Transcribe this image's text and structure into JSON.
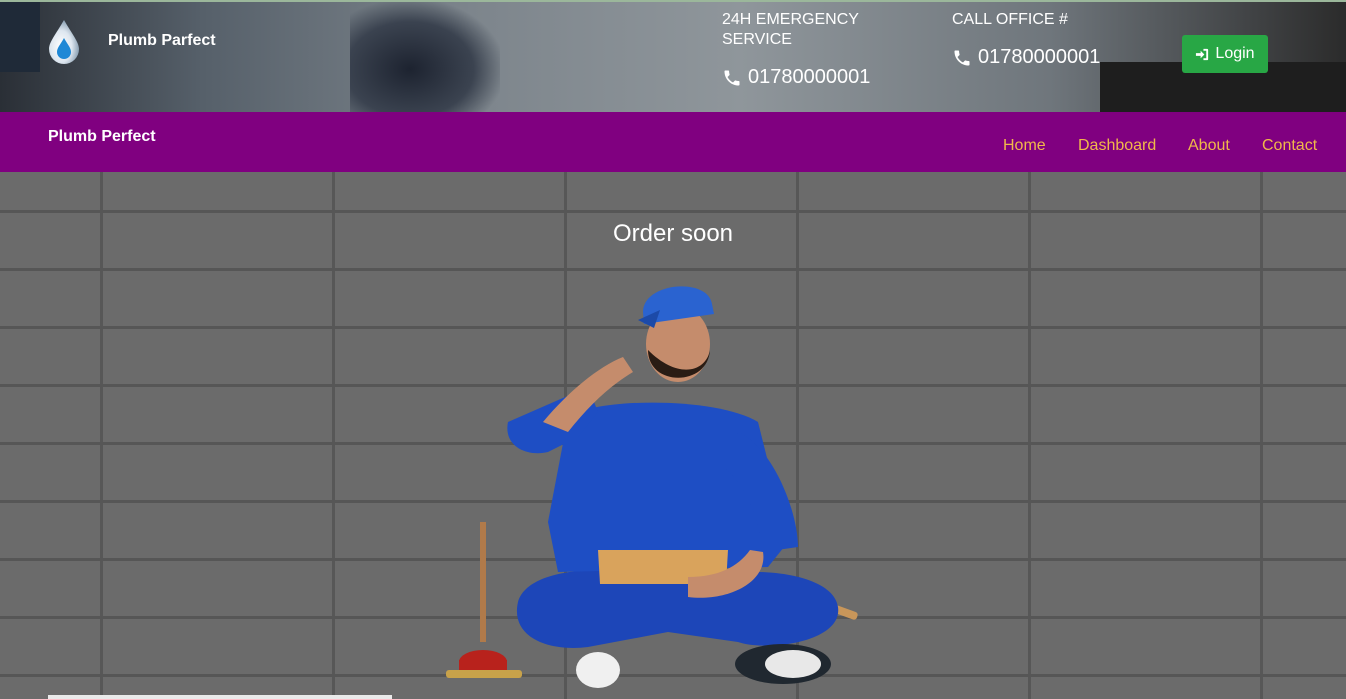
{
  "header": {
    "brand": "Plumb Parfect",
    "emergency_label": "24H EMERGENCY SERVICE",
    "emergency_phone": "01780000001",
    "office_label": "CALL OFFICE #",
    "office_phone": "01780000001",
    "login_label": "Login"
  },
  "nav": {
    "brand": "Plumb Perfect",
    "links": [
      "Home",
      "Dashboard",
      "About",
      "Contact"
    ]
  },
  "hero": {
    "title": "Order soon"
  },
  "colors": {
    "nav_bg": "#800080",
    "nav_link": "#f0b84a",
    "login_bg": "#28a745"
  },
  "icons": [
    "water-drop-icon",
    "phone-icon",
    "sign-in-icon"
  ]
}
